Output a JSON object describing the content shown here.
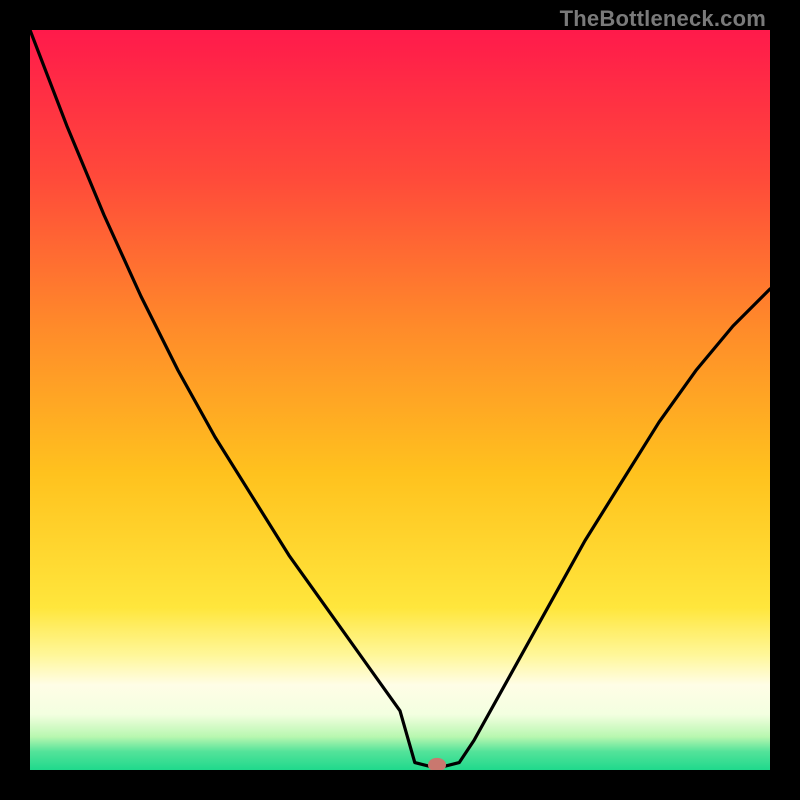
{
  "watermark": "TheBottleneck.com",
  "chart_data": {
    "type": "line",
    "title": "",
    "xlabel": "",
    "ylabel": "",
    "xlim": [
      0,
      100
    ],
    "ylim": [
      0,
      100
    ],
    "grid": false,
    "legend": false,
    "series": [
      {
        "name": "curve",
        "x": [
          0,
          5,
          10,
          15,
          20,
          25,
          30,
          35,
          40,
          45,
          50,
          51,
          52,
          54,
          56,
          58,
          60,
          65,
          70,
          75,
          80,
          85,
          90,
          95,
          100
        ],
        "values": [
          100,
          87,
          75,
          64,
          54,
          45,
          37,
          29,
          22,
          15,
          8,
          4.5,
          1,
          0.5,
          0.5,
          1,
          4,
          13,
          22,
          31,
          39,
          47,
          54,
          60,
          65
        ]
      }
    ],
    "marker": {
      "x": 55,
      "y": 0.7,
      "color": "#c9786f",
      "rx": 9,
      "ry": 7
    },
    "green_band": {
      "y_from": 0,
      "y_to": 3.8
    },
    "pale_band": {
      "y_from": 3.8,
      "y_to": 16
    },
    "gradient_stops": [
      {
        "offset": 0.0,
        "color": "#ff1a4b"
      },
      {
        "offset": 0.2,
        "color": "#ff4a3a"
      },
      {
        "offset": 0.4,
        "color": "#ff8a2a"
      },
      {
        "offset": 0.6,
        "color": "#ffc21e"
      },
      {
        "offset": 0.78,
        "color": "#ffe63c"
      },
      {
        "offset": 0.845,
        "color": "#fff79a"
      },
      {
        "offset": 0.885,
        "color": "#fffde6"
      },
      {
        "offset": 0.925,
        "color": "#f3ffe0"
      },
      {
        "offset": 0.955,
        "color": "#b8f7b0"
      },
      {
        "offset": 0.975,
        "color": "#54e39a"
      },
      {
        "offset": 1.0,
        "color": "#1fd98c"
      }
    ]
  }
}
